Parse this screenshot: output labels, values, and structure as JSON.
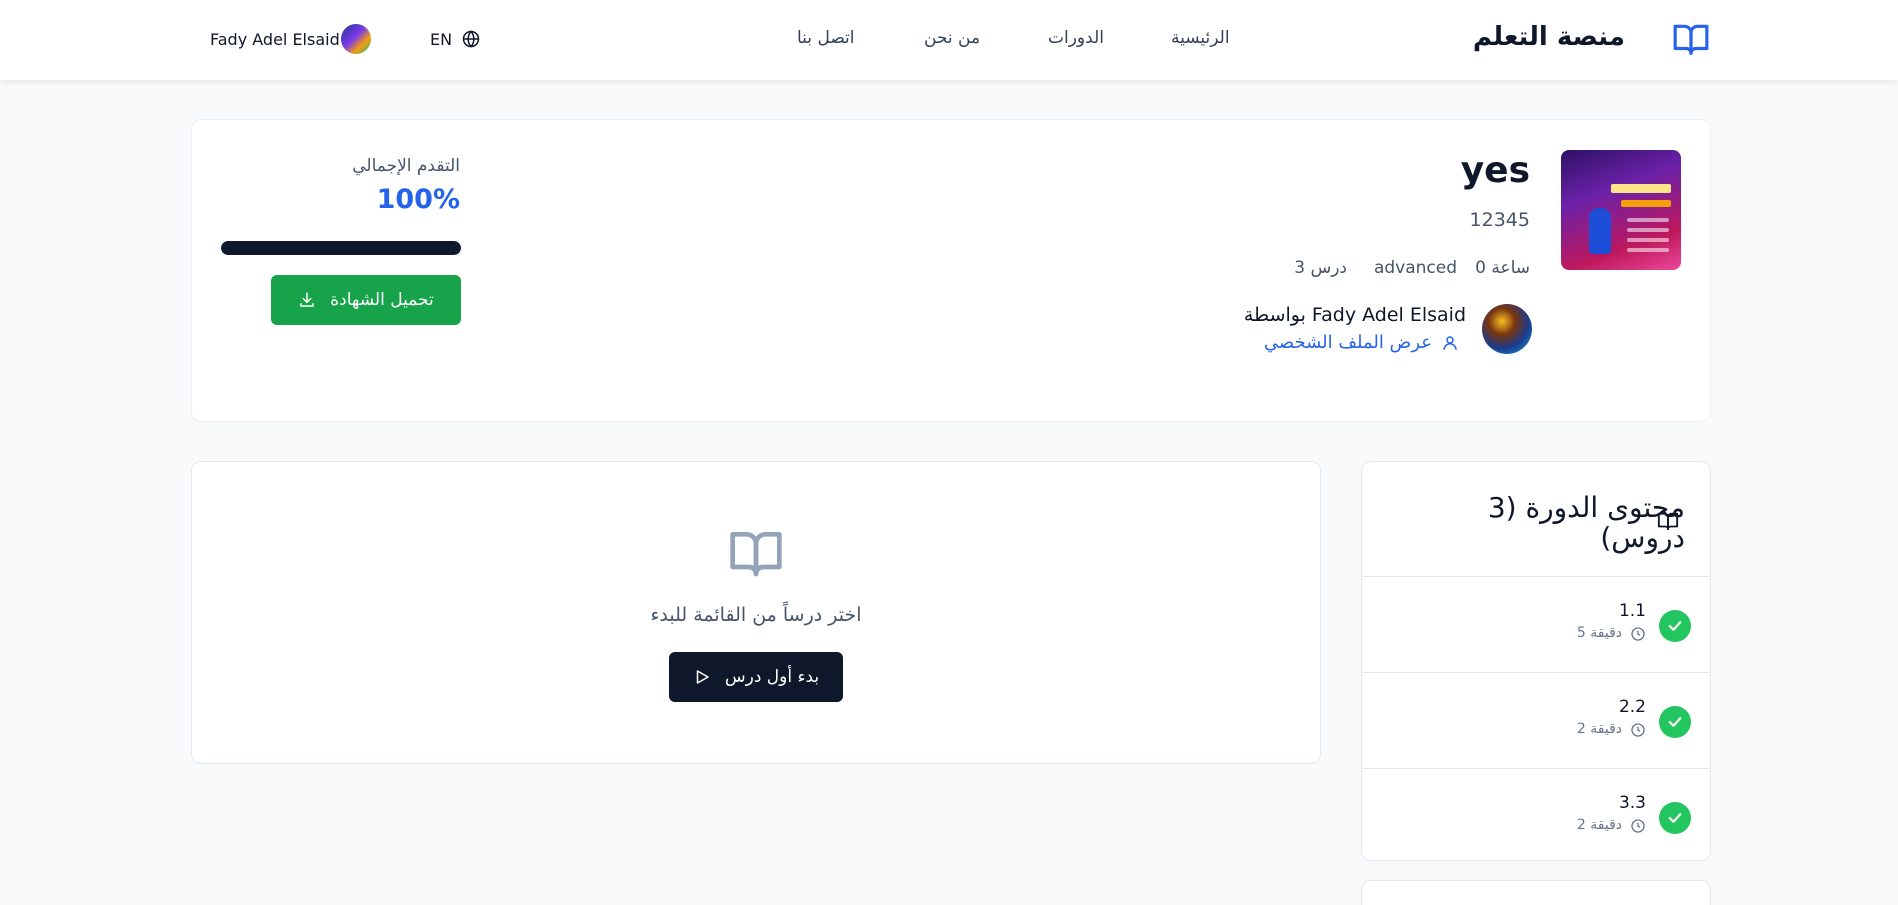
{
  "navbar": {
    "brand": "منصة التعلم",
    "links": [
      "الرئيسية",
      "الدورات",
      "من نحن",
      "اتصل بنا"
    ],
    "user_name": "Fady Adel Elsaid",
    "language": "EN"
  },
  "course": {
    "title": "yes",
    "code": "12345",
    "duration": "0 ساعة",
    "level": "advanced",
    "lessons_count": "3 درس",
    "instructor": "بواسطة Fady Adel Elsaid",
    "profile_link": "عرض الملف الشخصي",
    "progress_label": "التقدم الإجمالي",
    "progress_value": "100%",
    "progress_fraction": 1.0,
    "certificate_button": "تحميل الشهادة"
  },
  "content": {
    "empty_text": "اختر درساً من القائمة للبدء",
    "start_button": "بدء أول درس"
  },
  "lessons": {
    "title": "محتوى الدورة (3 دروس)",
    "items": [
      {
        "number": "1.1",
        "duration": "5 دقيقة",
        "completed": true
      },
      {
        "number": "2.2",
        "duration": "2 دقيقة",
        "completed": true
      },
      {
        "number": "3.3",
        "duration": "2 دقيقة",
        "completed": true
      }
    ]
  },
  "colors": {
    "accent": "#2563eb",
    "success": "#16a34a",
    "dark": "#0f172a"
  }
}
